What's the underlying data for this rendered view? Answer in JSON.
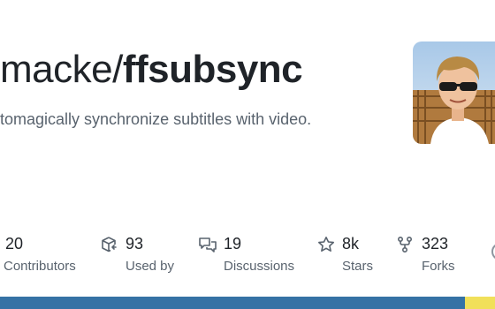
{
  "repo": {
    "owner_text": "macke/",
    "name": "ffsubsync",
    "description": "tomagically synchronize subtitles with video."
  },
  "stats": [
    {
      "icon": "people-icon",
      "value": "20",
      "label": "Contributors"
    },
    {
      "icon": "package-dependents-icon",
      "value": "93",
      "label": "Used by"
    },
    {
      "icon": "discussions-icon",
      "value": "19",
      "label": "Discussions"
    },
    {
      "icon": "star-icon",
      "value": "8k",
      "label": "Stars"
    },
    {
      "icon": "fork-icon",
      "value": "323",
      "label": "Forks"
    }
  ],
  "language_bar": {
    "colors": {
      "python": "#3572A5",
      "other": "#f1e05a"
    },
    "fractions": [
      0.94,
      0.06
    ]
  }
}
